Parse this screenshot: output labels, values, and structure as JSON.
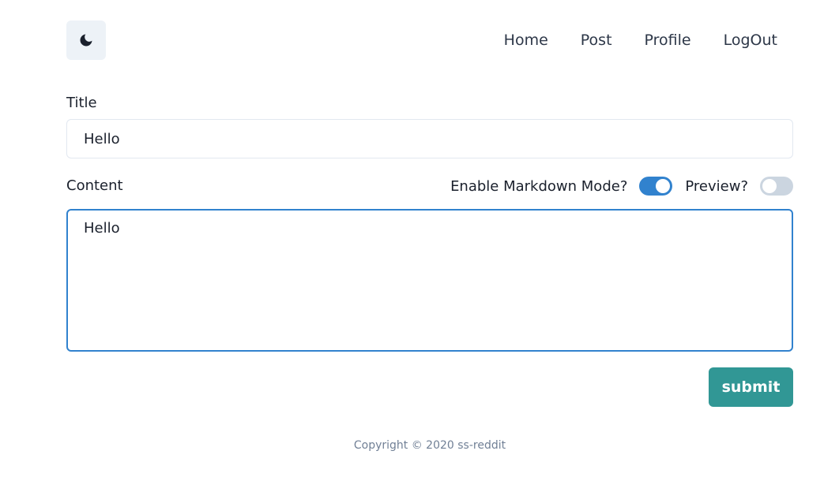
{
  "header": {
    "theme_icon": "moon-icon",
    "nav": [
      {
        "label": "Home"
      },
      {
        "label": "Post"
      },
      {
        "label": "Profile"
      },
      {
        "label": "LogOut"
      }
    ]
  },
  "form": {
    "title_label": "Title",
    "title_value": "Hello",
    "content_label": "Content",
    "markdown_label": "Enable Markdown Mode?",
    "markdown_enabled": true,
    "preview_label": "Preview?",
    "preview_enabled": false,
    "content_value": "Hello",
    "submit_label": "submit"
  },
  "footer": {
    "copyright": "Copyright © 2020 ss-reddit"
  },
  "colors": {
    "accent": "#3182ce",
    "submit": "#319795",
    "switch_off": "#cbd5e0"
  }
}
